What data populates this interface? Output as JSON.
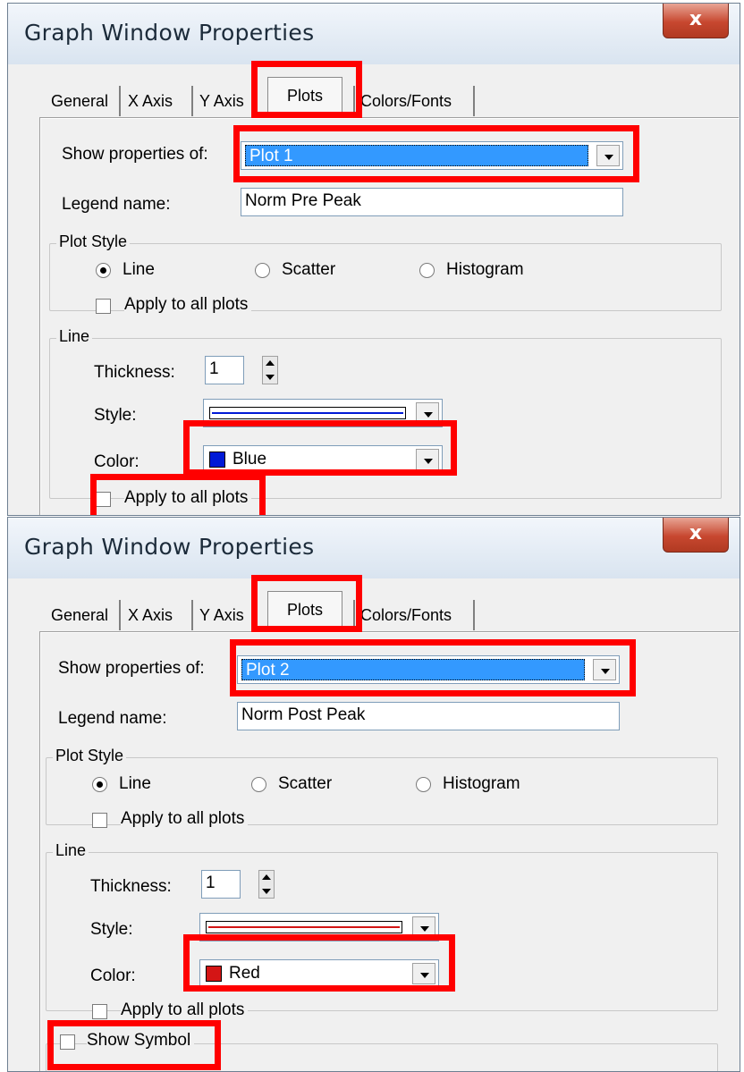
{
  "windows": [
    {
      "title": "Graph Window Properties",
      "close_label": "x",
      "tabs": [
        "General",
        "X Axis",
        "Y Axis",
        "Plots",
        "Colors/Fonts"
      ],
      "active_tab": "Plots",
      "show_properties_label": "Show properties of:",
      "show_properties_value": "Plot 1",
      "legend_label": "Legend name:",
      "legend_value": "Norm Pre Peak",
      "plot_style_group": "Plot Style",
      "radio_line": "Line",
      "radio_scatter": "Scatter",
      "radio_histogram": "Histogram",
      "apply_all_1": "Apply to all plots",
      "line_group": "Line",
      "thickness_label": "Thickness:",
      "thickness_value": "1",
      "style_label": "Style:",
      "color_label": "Color:",
      "color_value": "Blue",
      "color_hex": "#0019d6",
      "apply_all_2": "Apply to all plots"
    },
    {
      "title": "Graph Window Properties",
      "close_label": "x",
      "tabs": [
        "General",
        "X Axis",
        "Y Axis",
        "Plots",
        "Colors/Fonts"
      ],
      "active_tab": "Plots",
      "show_properties_label": "Show properties of:",
      "show_properties_value": "Plot 2",
      "legend_label": "Legend name:",
      "legend_value": "Norm Post Peak",
      "plot_style_group": "Plot Style",
      "radio_line": "Line",
      "radio_scatter": "Scatter",
      "radio_histogram": "Histogram",
      "apply_all_1": "Apply to all plots",
      "line_group": "Line",
      "thickness_label": "Thickness:",
      "thickness_value": "1",
      "style_label": "Style:",
      "color_label": "Color:",
      "color_value": "Red",
      "color_hex": "#d41515",
      "apply_all_2": "Apply to all plots",
      "show_symbol_label": "Show Symbol"
    }
  ],
  "colors": {
    "highlight": "#ff0000",
    "selection": "#3399ff"
  }
}
